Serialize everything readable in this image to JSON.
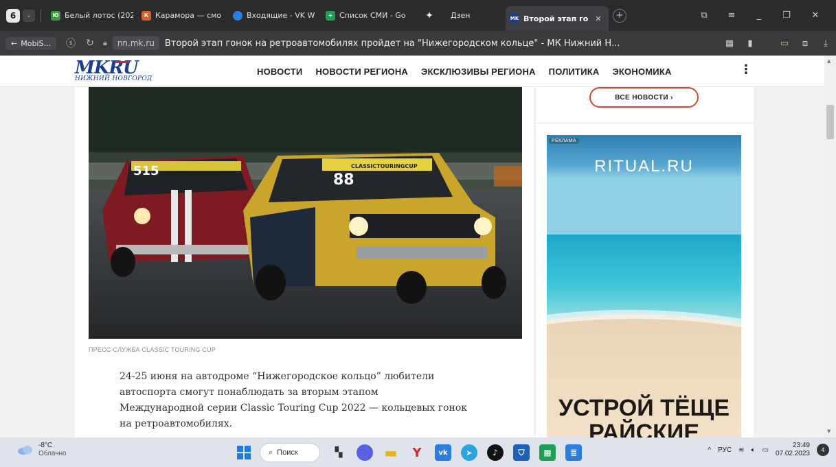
{
  "browser": {
    "tab_count": "6",
    "tabs": [
      {
        "label": "Белый лотос (202",
        "favicon_color": "#3c9a3c",
        "favicon_text": "Ю"
      },
      {
        "label": "Карамора — смо",
        "favicon_color": "#d9602a",
        "favicon_text": "К"
      },
      {
        "label": "Входящие - VK W",
        "favicon_color": "#2b7de0",
        "favicon_text": ""
      },
      {
        "label": "Список СМИ - Go",
        "favicon_color": "#1f9e55",
        "favicon_text": "+"
      },
      {
        "label": "Дзен",
        "favicon_color": "#2b2b2e",
        "favicon_text": "✦"
      },
      {
        "label": "Второй этап го",
        "favicon_color": "#1a3d8f",
        "favicon_text": "MK",
        "active": true
      }
    ],
    "back_label": "MobiS...",
    "domain": "nn.mk.ru",
    "page_title": "Второй этап гонок на ретроавтомобилях пройдет на \"Нижегородском кольце\" - МК Нижний Н..."
  },
  "site": {
    "logo_main": "MKRU",
    "logo_sub": "НИЖНИЙ НОВГОРОД",
    "nav": [
      "НОВОСТИ",
      "НОВОСТИ РЕГИОНА",
      "ЭКСКЛЮЗИВЫ РЕГИОНА",
      "ПОЛИТИКА",
      "ЭКОНОМИКА"
    ],
    "brand_color": "#1a3d8f",
    "accent_color": "#d7462d"
  },
  "article": {
    "caption": "ПРЕСС-СЛУЖБА CLASSIC TOURING CUP",
    "lead_lines": [
      "24-25 июня на автодроме “Нижегородское кольцо” любители",
      "автоспорта смогут понаблюдать за вторым этапом",
      "Международной серии Classic Touring Cup 2022 — кольцевых гонок",
      "на ретроавтомобилях."
    ],
    "photo": {
      "car_front_number": "88",
      "car_back_number": "515",
      "windshield_banner": "CLASSICTOURINGCUP"
    }
  },
  "sidebar": {
    "all_news_label": "ВСЕ НОВОСТИ ›",
    "ad": {
      "badge": "РЕКЛАМА",
      "brand": "RITUAL.RU",
      "slogan_line1": "УСТРОЙ ТЁЩЕ",
      "slogan_line2": "РАЙСКИЕ"
    }
  },
  "taskbar": {
    "temperature": "-8°C",
    "condition": "Облачно",
    "search_label": "Поиск",
    "language": "РУС",
    "time": "23:49",
    "date": "07.02.2023",
    "notifications": "4"
  }
}
